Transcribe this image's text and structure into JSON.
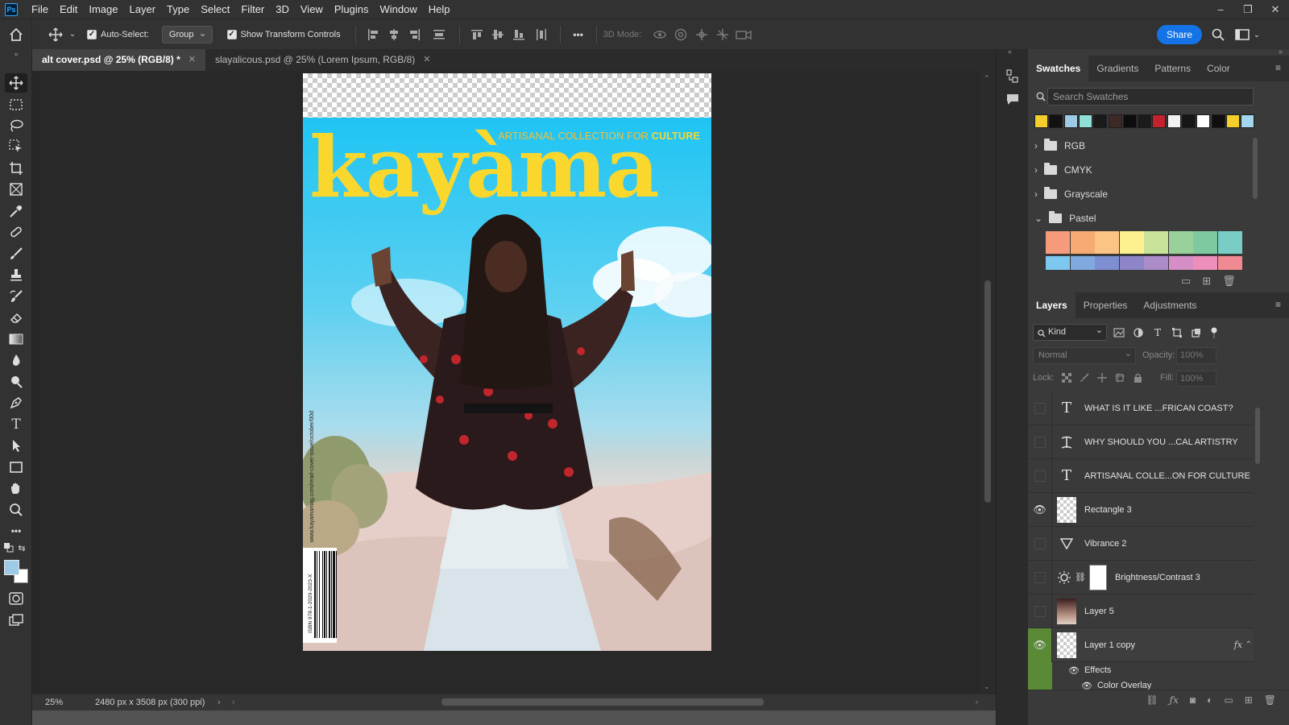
{
  "app": {
    "logo": "Ps"
  },
  "menu": [
    "File",
    "Edit",
    "Image",
    "Layer",
    "Type",
    "Select",
    "Filter",
    "3D",
    "View",
    "Plugins",
    "Window",
    "Help"
  ],
  "window_controls": {
    "minimize": "–",
    "restore": "❐",
    "close": "✕"
  },
  "options": {
    "auto_select_label": "Auto-Select:",
    "auto_select_checked": true,
    "auto_select_value": "Group",
    "transform_label": "Show Transform Controls",
    "transform_checked": true,
    "more_label": "•••",
    "mode_label": "3D Mode:",
    "share_label": "Share"
  },
  "tabs": [
    {
      "label": "alt cover.psd @ 25% (RGB/8) *",
      "active": true
    },
    {
      "label": "slayalicous.psd @ 25% (Lorem Ipsum, RGB/8)",
      "active": false
    }
  ],
  "document": {
    "title": "kayàma",
    "tagline_prefix": "ARTISANAL COLLECTION FOR ",
    "tagline_emphasis": "CULTURE",
    "url_text": "www.kayamamag.com/read-cover-issue/october/00d",
    "isbn_text": "ISBN 978-1-2020-2023-X"
  },
  "status": {
    "zoom": "25%",
    "doc_size": "2480 px x 3508 px (300 ppi)"
  },
  "swatches_panel": {
    "tabs": [
      "Swatches",
      "Gradients",
      "Patterns",
      "Color"
    ],
    "active_tab": "Swatches",
    "search_placeholder": "Search Swatches",
    "recent_colors": [
      "#f4cf2b",
      "#111111",
      "#9dcbe5",
      "#8fe0d6",
      "#1a1a1a",
      "#3d2a26",
      "#0c0c0c",
      "#1b1b1b",
      "#c4212e",
      "#f2f2f2",
      "#161616",
      "#ffffff",
      "#0e0e0e",
      "#f4cf2b",
      "#a3d6ef"
    ],
    "groups": [
      {
        "name": "RGB",
        "expanded": false
      },
      {
        "name": "CMYK",
        "expanded": false
      },
      {
        "name": "Grayscale",
        "expanded": false
      },
      {
        "name": "Pastel",
        "expanded": true
      }
    ],
    "pastel_row1": [
      "#f59a7a",
      "#f7ab74",
      "#fbc384",
      "#fdf08e",
      "#c8e29a",
      "#98d29a",
      "#7fc9a1",
      "#78cdc5"
    ],
    "pastel_row2": [
      "#7cc8ef",
      "#7fa9df",
      "#7d8ed1",
      "#8c86c8",
      "#ab8cc8",
      "#d58fc6",
      "#ee8fbb",
      "#f08a92"
    ]
  },
  "layers_panel": {
    "tabs": [
      "Layers",
      "Properties",
      "Adjustments"
    ],
    "active_tab": "Layers",
    "filter_kind": "Kind",
    "blend_mode": "Normal",
    "opacity_label": "Opacity:",
    "opacity_value": "100%",
    "lock_label": "Lock:",
    "fill_label": "Fill:",
    "fill_value": "100%",
    "layers": [
      {
        "name": "WHAT IS IT  LIKE ...FRICAN  COAST?",
        "type": "text",
        "visible": false
      },
      {
        "name": "WHY SHOULD YOU  ...CAL ARTISTRY",
        "type": "text-warp",
        "visible": false
      },
      {
        "name": "ARTISANAL COLLE...ON FOR CULTURE",
        "type": "text",
        "visible": false
      },
      {
        "name": "Rectangle 3",
        "type": "raster",
        "visible": true
      },
      {
        "name": "Vibrance 2",
        "type": "vibrance",
        "visible": false
      },
      {
        "name": "Brightness/Contrast 3",
        "type": "brightness",
        "visible": false
      },
      {
        "name": "Layer 5",
        "type": "photo",
        "visible": false
      },
      {
        "name": "Layer 1 copy",
        "type": "raster",
        "visible": true,
        "fx": "fx",
        "selected": true
      }
    ],
    "effects_label": "Effects",
    "color_overlay_label": "Color Overlay"
  },
  "colors": {
    "foreground": "#9dcbe5",
    "background": "#ffffff",
    "accent": "#1473e6",
    "selected_layer": "#5a8a36"
  }
}
